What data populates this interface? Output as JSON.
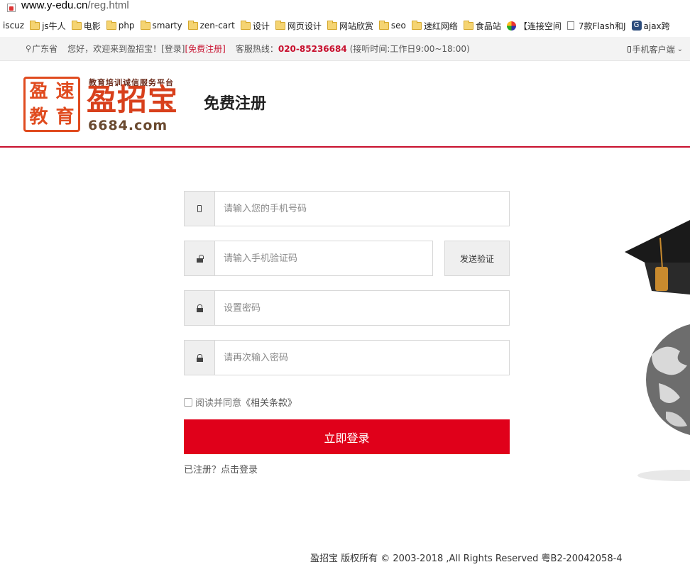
{
  "browser": {
    "url_domain": "www.y-edu.cn",
    "url_path": "/reg.html",
    "bookmarks": [
      {
        "label": "iscuz",
        "icon": "none"
      },
      {
        "label": "js牛人",
        "icon": "folder-icon"
      },
      {
        "label": "电影",
        "icon": "folder-icon"
      },
      {
        "label": "php",
        "icon": "folder-icon"
      },
      {
        "label": "smarty",
        "icon": "folder-icon"
      },
      {
        "label": "zen-cart",
        "icon": "folder-icon"
      },
      {
        "label": "设计",
        "icon": "folder-icon"
      },
      {
        "label": "网页设计",
        "icon": "folder-icon"
      },
      {
        "label": "网站欣赏",
        "icon": "folder-icon"
      },
      {
        "label": "seo",
        "icon": "folder-icon"
      },
      {
        "label": "速红网络",
        "icon": "folder-icon"
      },
      {
        "label": "食品站",
        "icon": "folder-icon"
      },
      {
        "label": "【连接空间",
        "icon": "site-icon"
      },
      {
        "label": "7款Flash和J",
        "icon": "page-icon"
      },
      {
        "label": "ajax跨",
        "icon": "site-icon-a"
      }
    ]
  },
  "topbar": {
    "location": "广东省",
    "welcome": "您好，欢迎来到盈招宝！",
    "login_link": "[登录]",
    "register_link": "[免费注册]",
    "hotline_label": "客服热线：",
    "hotline_number": "020-85236684",
    "hotline_hours": "(接听时间:工作日9:00~18:00)",
    "mobile_client": "手机客户端"
  },
  "header": {
    "logo_chars": [
      "盈",
      "速",
      "教",
      "育"
    ],
    "slogan": "教育培训诚信服务平台",
    "brand": "盈招宝",
    "domain": "6684.com",
    "page_title": "免费注册"
  },
  "form": {
    "phone_placeholder": "请输入您的手机号码",
    "code_placeholder": "请输入手机验证码",
    "send_code_label": "发送验证",
    "password_placeholder": "设置密码",
    "password_confirm_placeholder": "请再次输入密码",
    "agree_text": "阅读并同意",
    "terms_link": "《相关条款》",
    "submit_label": "立即登录",
    "login_prompt": "已注册？点击登录"
  },
  "footer": {
    "copyright": "盈招宝 版权所有 © 2003-2018 ,All Rights Reserved 粤B2-20042058-4"
  },
  "colors": {
    "accent_red": "#e0001a",
    "logo_orange": "#d8401c"
  }
}
